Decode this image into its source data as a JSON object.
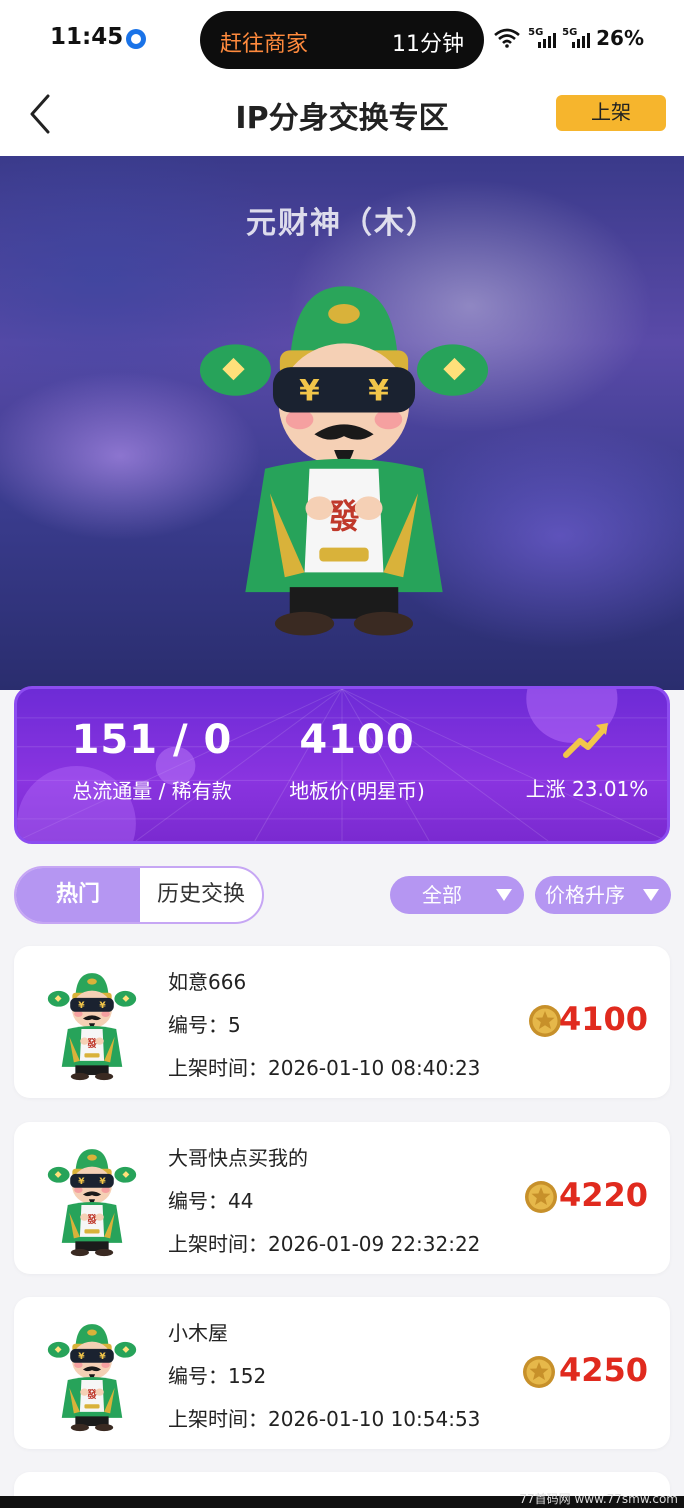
{
  "status_bar": {
    "time": "11:45",
    "pill_left": "赶往商家",
    "pill_right": "11分钟",
    "sig1": "5G",
    "sig2": "5G",
    "battery": "26%"
  },
  "header": {
    "title": "IP分身交换专区",
    "list_button": "上架"
  },
  "hero": {
    "name": "元财神（木）",
    "figure_icon": "cai-shen-figure"
  },
  "stats": {
    "circulation": {
      "value": "151 / 0",
      "label": "总流通量 / 稀有款"
    },
    "floor_price": {
      "value": "4100",
      "label": "地板价(明星币)"
    },
    "trend": {
      "label": "上涨 23.01%",
      "icon": "trend-up-icon"
    }
  },
  "filters": {
    "tabs": [
      "热门",
      "历史交换"
    ],
    "category": "全部",
    "sort": "价格升序"
  },
  "listings": [
    {
      "title": "如意666",
      "id": "编号：5",
      "time": "上架时间：2026-01-10 08:40:23",
      "price": "4100"
    },
    {
      "title": "大哥快点买我的",
      "id": "编号：44",
      "time": "上架时间：2026-01-09 22:32:22",
      "price": "4220"
    },
    {
      "title": "小木屋",
      "id": "编号：152",
      "time": "上架时间：2026-01-10 10:54:53",
      "price": "4250"
    }
  ],
  "watermark": "77首码网 www.77smw.com",
  "colors": {
    "accent": "#b596f2",
    "price": "#e02a1e",
    "list_button": "#f6b52d"
  }
}
